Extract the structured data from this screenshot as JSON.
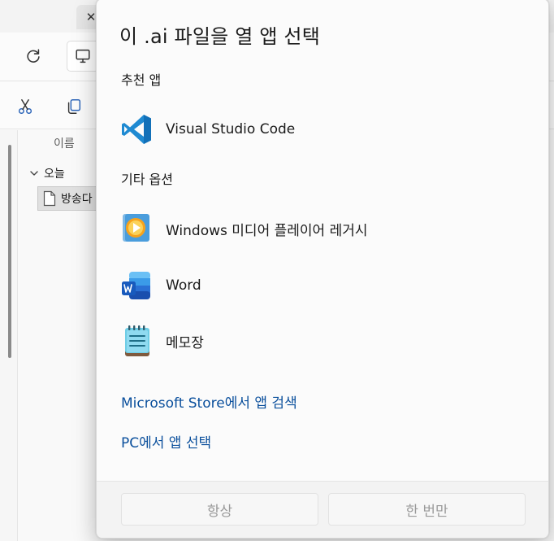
{
  "explorer": {
    "close_tab_glyph": "✕",
    "column_name": "이름",
    "group_label": "오늘",
    "file_name": "방송다"
  },
  "dialog": {
    "title": "이 .ai 파일을 열 앱 선택",
    "recommended_label": "추천 앱",
    "recommended_apps": [
      {
        "name": "Visual Studio Code",
        "icon": "vscode-icon"
      }
    ],
    "other_label": "기타 옵션",
    "other_apps": [
      {
        "name": "Windows 미디어 플레이어 레거시",
        "icon": "media-player-icon"
      },
      {
        "name": "Word",
        "icon": "word-icon"
      },
      {
        "name": "메모장",
        "icon": "notepad-icon"
      }
    ],
    "links": {
      "store": "Microsoft Store에서 앱 검색",
      "pc": "PC에서 앱 선택"
    },
    "buttons": {
      "always": "항상",
      "just_once": "한 번만"
    }
  },
  "colors": {
    "link": "#0a4f9c",
    "vscode_blue": "#1f8ad2",
    "word_blue": "#185abd",
    "disabled_text": "#9a9a9a"
  }
}
